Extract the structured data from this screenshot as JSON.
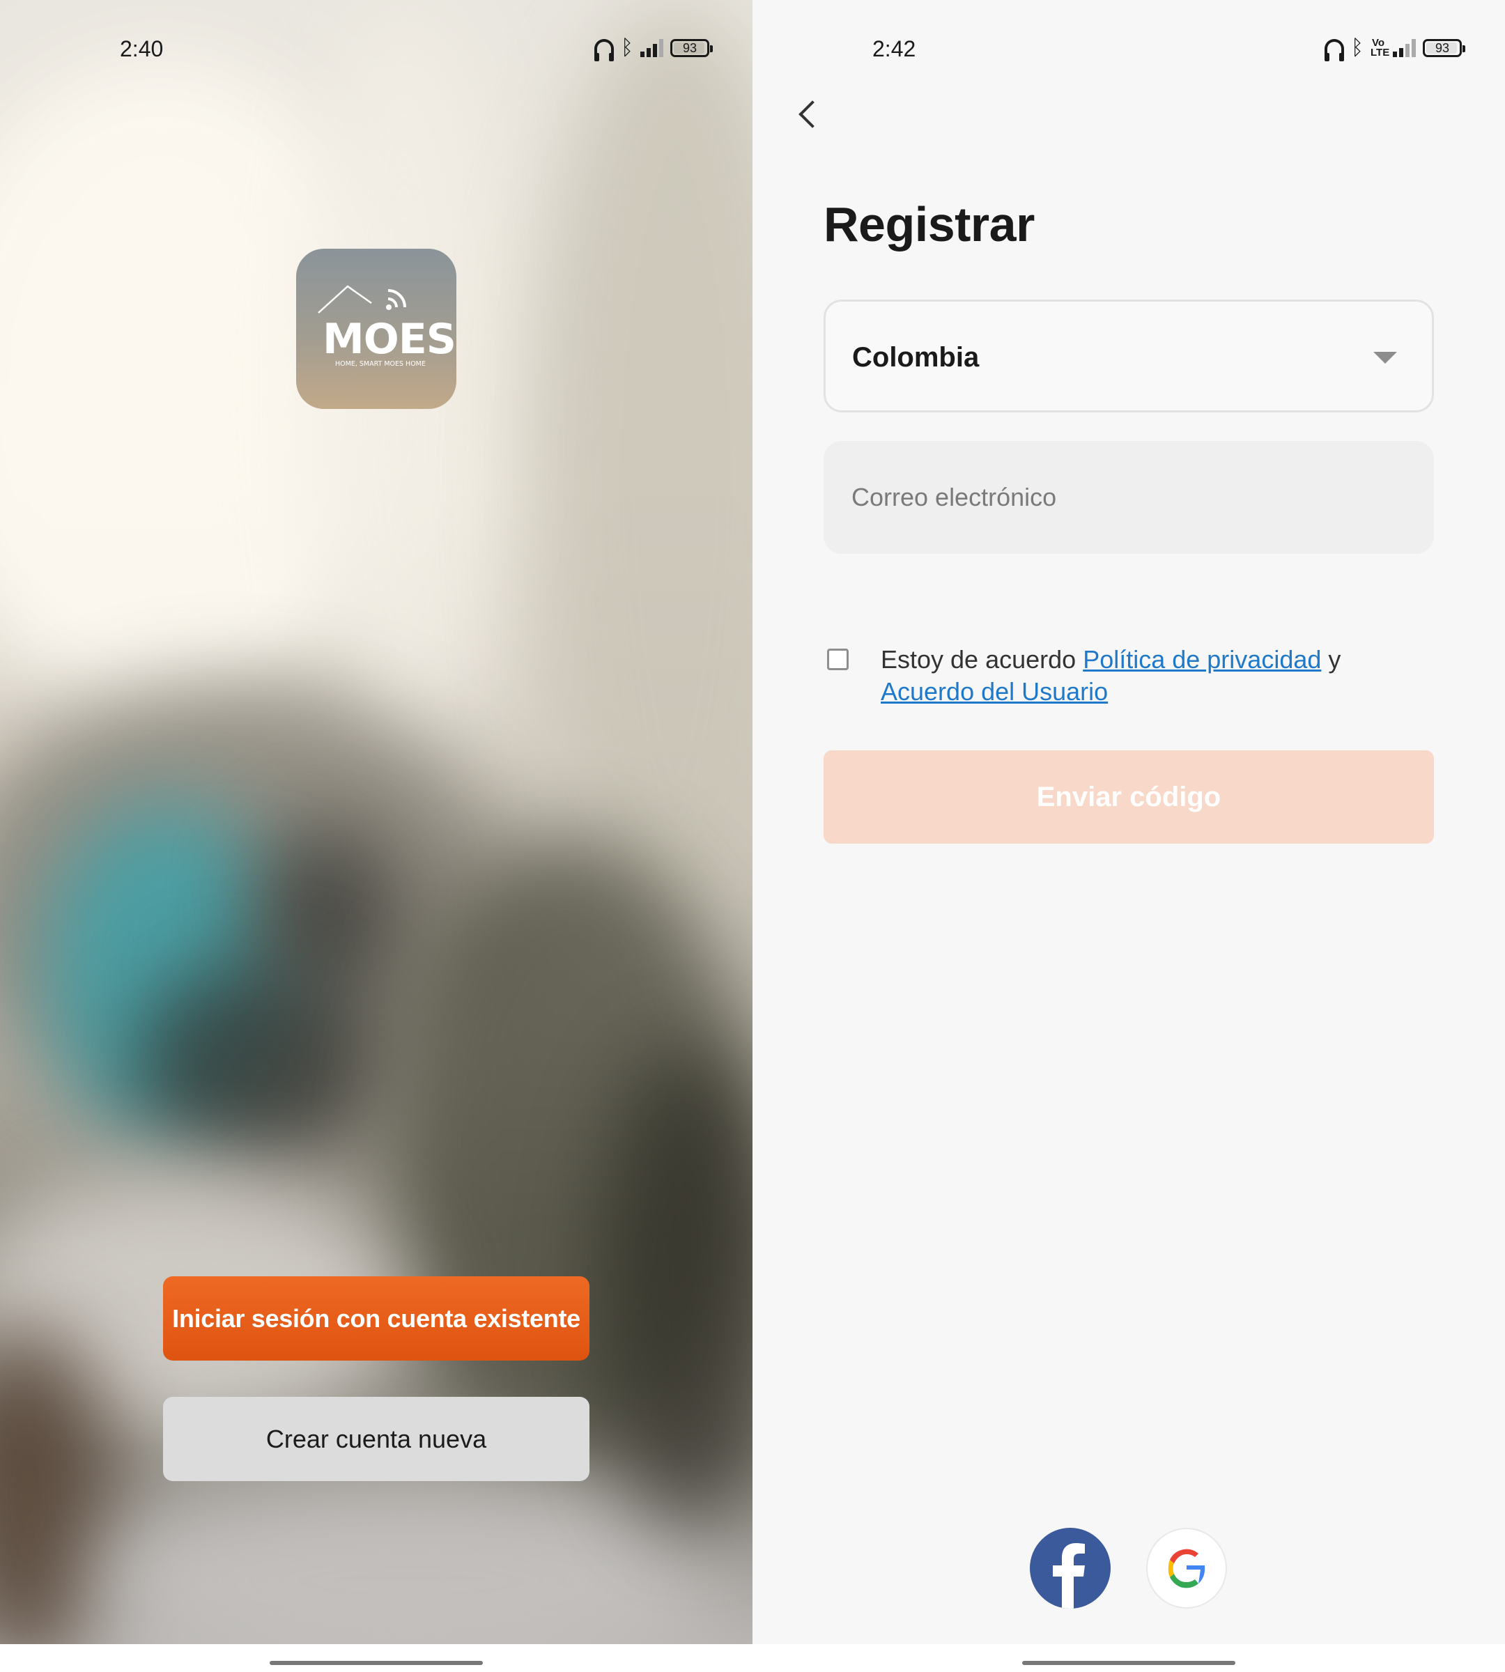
{
  "left_screen": {
    "status_bar": {
      "time": "2:40",
      "battery": "93"
    },
    "logo": {
      "brand": "MOES",
      "tagline": "HOME, SMART MOES HOME"
    },
    "buttons": {
      "login_label": "Iniciar sesión con cuenta existente",
      "create_label": "Crear cuenta nueva"
    },
    "colors": {
      "login_button": "#e35a16",
      "create_button": "#dcdcdc"
    }
  },
  "right_screen": {
    "status_bar": {
      "time": "2:42",
      "battery": "93"
    },
    "title": "Registrar",
    "country": {
      "selected": "Colombia"
    },
    "email": {
      "placeholder": "Correo electrónico",
      "value": ""
    },
    "agreement": {
      "checked": false,
      "prefix": "Estoy de acuerdo ",
      "privacy_link": "Política de privacidad",
      "conjunction": " y ",
      "user_agreement_link": "Acuerdo del Usuario"
    },
    "send_button": {
      "label": "Enviar código",
      "enabled": false
    },
    "social": {
      "icons": [
        "facebook-icon",
        "google-icon"
      ]
    },
    "colors": {
      "send_button_disabled": "#f8d9c9",
      "link": "#1f79c8",
      "facebook": "#3b5a9b"
    }
  }
}
